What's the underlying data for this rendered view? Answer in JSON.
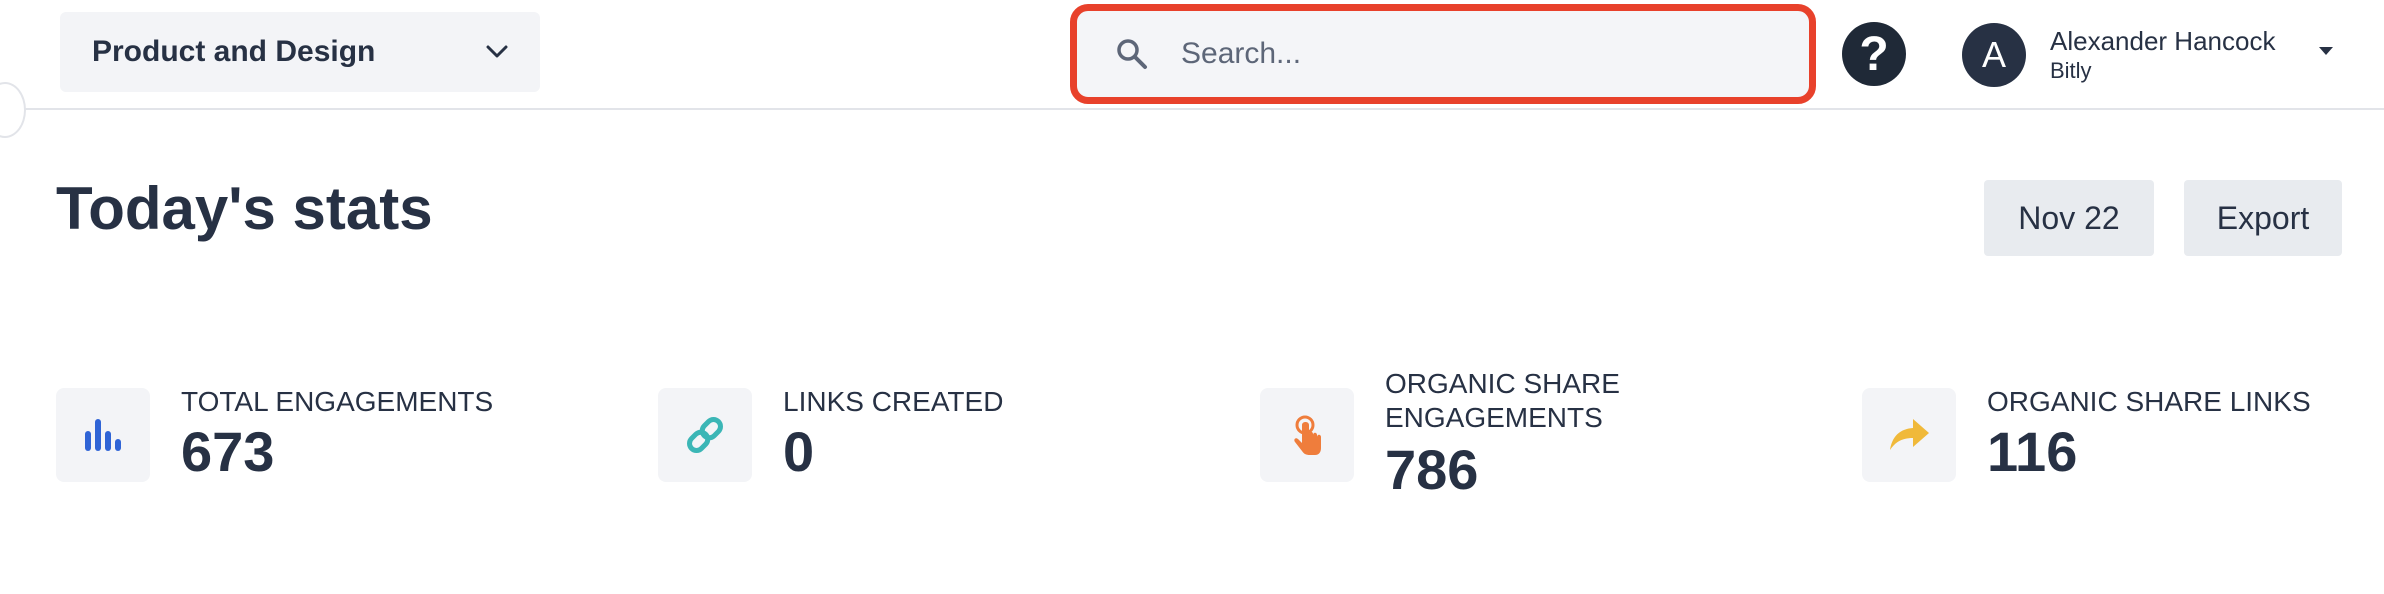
{
  "header": {
    "workspace": "Product and Design",
    "search_placeholder": "Search...",
    "help_symbol": "?",
    "user": {
      "initial": "A",
      "name": "Alexander Hancock",
      "org": "Bitly"
    }
  },
  "page": {
    "title": "Today's stats",
    "date_button": "Nov 22",
    "export_button": "Export"
  },
  "stats": [
    {
      "label": "TOTAL ENGAGEMENTS",
      "value": "673",
      "icon": "bar-chart-icon",
      "color": "#2f64d6"
    },
    {
      "label": "LINKS CREATED",
      "value": "0",
      "icon": "link-icon",
      "color": "#3bb6b6"
    },
    {
      "label_line1": "ORGANIC SHARE",
      "label_line2": "ENGAGEMENTS",
      "value": "786",
      "icon": "tap-hand-icon",
      "color": "#ef7d3c"
    },
    {
      "label": "ORGANIC SHARE LINKS",
      "value": "116",
      "icon": "share-arrow-icon",
      "color": "#f0b93a"
    }
  ]
}
